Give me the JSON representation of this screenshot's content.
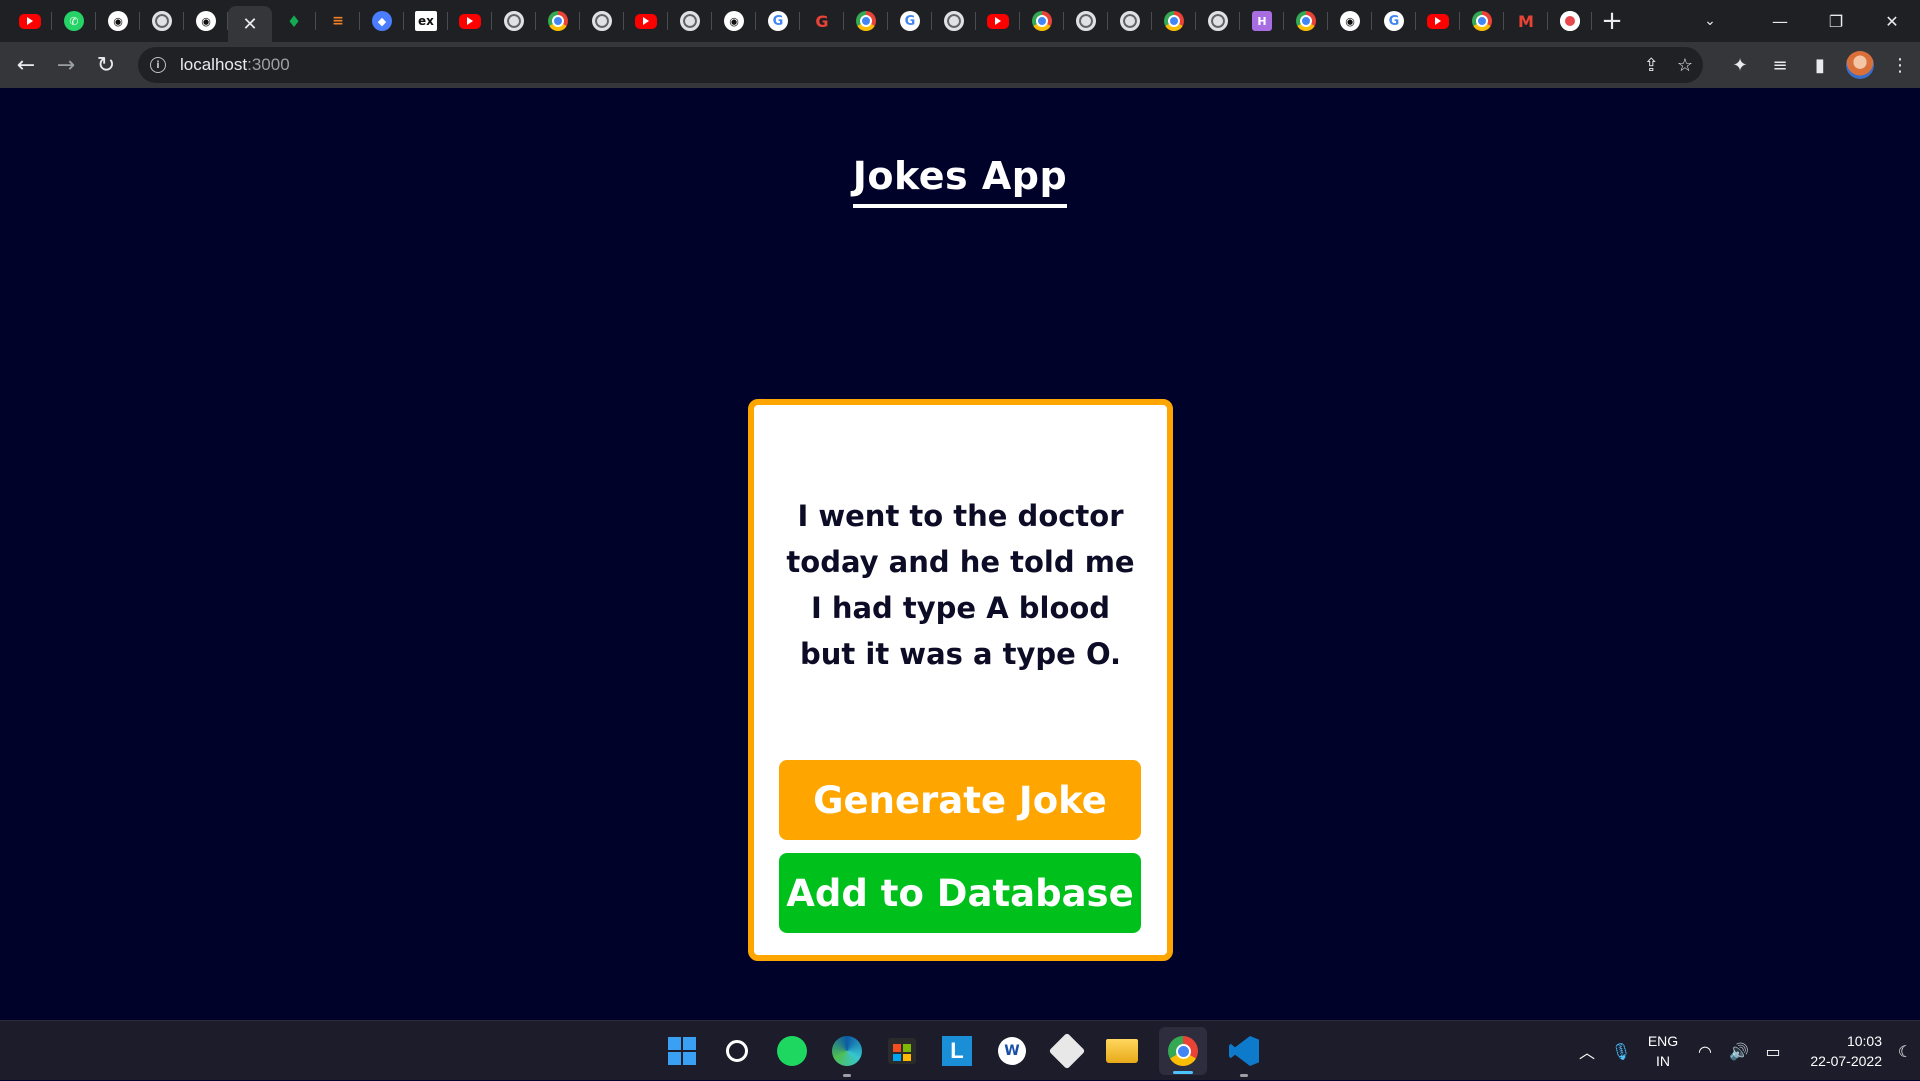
{
  "browser": {
    "tabs": [
      {
        "icon": "youtube-icon",
        "glyph": ""
      },
      {
        "icon": "whatsapp-icon",
        "glyph": "✆"
      },
      {
        "icon": "github-icon",
        "glyph": "◉"
      },
      {
        "icon": "globe-icon",
        "glyph": ""
      },
      {
        "icon": "github-icon",
        "glyph": "◉"
      },
      {
        "icon": "close-icon",
        "glyph": "✕",
        "active": true
      },
      {
        "icon": "mongodb-icon",
        "glyph": "♦"
      },
      {
        "icon": "stackoverflow-icon",
        "glyph": "≡"
      },
      {
        "icon": "bluecircle-icon",
        "glyph": "◆"
      },
      {
        "icon": "ex-icon",
        "glyph": "ex"
      },
      {
        "icon": "youtube-icon",
        "glyph": ""
      },
      {
        "icon": "globe-icon",
        "glyph": ""
      },
      {
        "icon": "chrome-icon",
        "glyph": ""
      },
      {
        "icon": "globe-icon",
        "glyph": ""
      },
      {
        "icon": "youtube-icon",
        "glyph": ""
      },
      {
        "icon": "globe-icon",
        "glyph": ""
      },
      {
        "icon": "github-icon",
        "glyph": "◉"
      },
      {
        "icon": "google-icon",
        "glyph": "G"
      },
      {
        "icon": "google-red-icon",
        "glyph": "G"
      },
      {
        "icon": "chrome-icon",
        "glyph": ""
      },
      {
        "icon": "google-icon",
        "glyph": "G"
      },
      {
        "icon": "globe-icon",
        "glyph": ""
      },
      {
        "icon": "youtube-icon",
        "glyph": ""
      },
      {
        "icon": "chrome-icon",
        "glyph": ""
      },
      {
        "icon": "globe-icon",
        "glyph": ""
      },
      {
        "icon": "globe-icon",
        "glyph": ""
      },
      {
        "icon": "chrome-icon",
        "glyph": ""
      },
      {
        "icon": "globe-icon",
        "glyph": ""
      },
      {
        "icon": "hackerrank-icon",
        "glyph": "H"
      },
      {
        "icon": "chrome-icon",
        "glyph": ""
      },
      {
        "icon": "github-icon",
        "glyph": "◉"
      },
      {
        "icon": "google-icon",
        "glyph": "G"
      },
      {
        "icon": "youtube-icon",
        "glyph": ""
      },
      {
        "icon": "chrome-icon",
        "glyph": ""
      },
      {
        "icon": "gmail-icon",
        "glyph": "M"
      },
      {
        "icon": "record-icon",
        "glyph": ""
      }
    ],
    "url_host": "localhost",
    "url_port": ":3000"
  },
  "app": {
    "title": "Jokes App",
    "joke": "I went to the doctor today and he told me I had type A blood but it was a type O.",
    "generate_label": "Generate Joke",
    "add_label": "Add to Database"
  },
  "colors": {
    "background": "#00022a",
    "card_border": "#ffa500",
    "generate_button": "#ffa500",
    "add_button": "#00c11b"
  },
  "taskbar": {
    "language_line1": "ENG",
    "language_line2": "IN",
    "time": "10:03",
    "date": "22-07-2022"
  }
}
